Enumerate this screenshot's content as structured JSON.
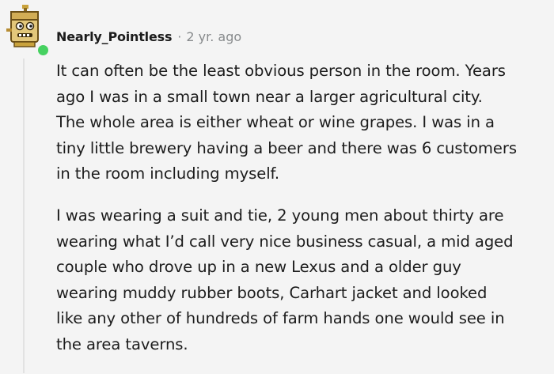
{
  "comment": {
    "username": "Nearly_Pointless",
    "separator": "·",
    "age": "2 yr. ago",
    "avatar_icon": "robot-box-avatar-icon",
    "online_color": "#46d160",
    "paragraphs": [
      {
        "lines": [
          "It can often be the least obvious person in the room. Years",
          "ago I was in a small town near a larger agricultural city.",
          "The whole area is either wheat or wine grapes. I was in a",
          "tiny little brewery having a beer and there was 6 customers",
          "in the room including myself."
        ]
      },
      {
        "lines": [
          "I was wearing a suit and tie, 2 young men about thirty are",
          "wearing what I’d call very nice business casual, a mid aged",
          "couple who drove up in a new Lexus and a older guy",
          "wearing muddy rubber boots, Carhart jacket and looked",
          "like any other of hundreds of farm hands one would see in",
          "the area taverns."
        ]
      }
    ]
  }
}
